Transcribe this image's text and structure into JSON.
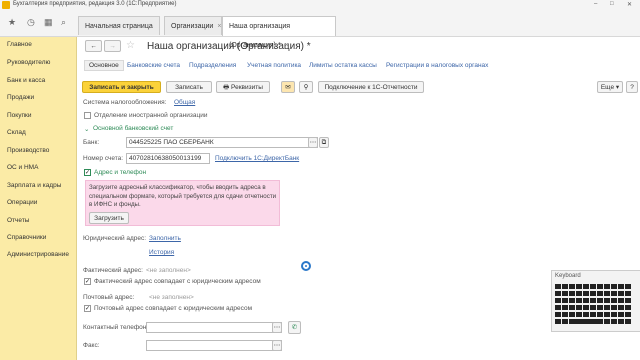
{
  "window": {
    "title": "Бухгалтерия предприятия, редакция 3.0  (1С:Предприятие)"
  },
  "tabs": [
    {
      "label": "Начальная страница"
    },
    {
      "label": "Организации"
    },
    {
      "label": "Наша организация (Организация) *"
    }
  ],
  "sidebar": {
    "items": [
      "Главное",
      "Руководителю",
      "Банк и касса",
      "Продажи",
      "Покупки",
      "Склад",
      "Производство",
      "ОС и НМА",
      "Зарплата и кадры",
      "Операции",
      "Отчеты",
      "Справочники",
      "Администрирование"
    ]
  },
  "form": {
    "title": "Наша организация (Организация) *",
    "nav_tabs": [
      "Основное",
      "Банковские счета",
      "Подразделения",
      "Учетная политика",
      "Лимиты остатка кассы",
      "Регистрации в налоговых органах"
    ],
    "buttons": {
      "save_close": "Записать и закрыть",
      "save": "Записать",
      "requisites": "Реквизиты",
      "connect": "Подключение к 1С-Отчетности",
      "more": "Еще",
      "help": "?"
    },
    "tax_system_label": "Система налогообложения:",
    "tax_system_value": "Общая",
    "foreign_branch": "Отделение иностранной организации",
    "bank_section": "Основной банковский счет",
    "bank_label": "Банк:",
    "bank_value": "044525225 ПАО СБЕРБАНК",
    "account_label": "Номер счета:",
    "account_value": "40702810638050013199",
    "direct_bank_link": "Подключить 1С:ДиректБанк",
    "address_section": "Адрес и телефон",
    "notice_text": "Загрузите адресный классификатор, чтобы вводить адреса в специальном формате, который требуется для сдачи отчетности в ИФНС и фонды.",
    "load_button": "Загрузить",
    "legal_address_label": "Юридический адрес:",
    "legal_address_fill": "Заполнить",
    "legal_address_history": "История",
    "actual_address_label": "Фактический адрес:",
    "not_filled": "<не заполнен>",
    "actual_same": "Фактический адрес совпадает с юридическим адресом",
    "postal_address_label": "Почтовый адрес:",
    "postal_same": "Почтовый адрес совпадает с юридическим адресом",
    "phone_label": "Контактный телефон:",
    "fax_label": "Факс:"
  },
  "keyboard_widget": {
    "title": "Keyboard"
  }
}
